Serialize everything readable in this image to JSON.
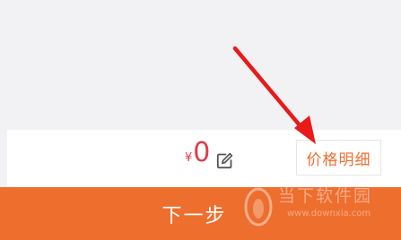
{
  "price": {
    "currency_symbol": "¥",
    "amount": "0",
    "edit_icon": "edit-icon",
    "color": "#e23b47"
  },
  "detail_button": {
    "label": "价格明细",
    "color": "#ee6e2e"
  },
  "next_button": {
    "label": "下一步",
    "background": "#ee6e2e"
  },
  "watermark": {
    "name": "当下软件园",
    "url": "www.downxia.com"
  },
  "annotation": {
    "arrow_color": "#e81a1a"
  }
}
